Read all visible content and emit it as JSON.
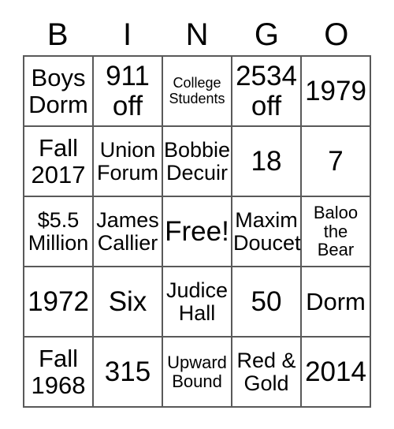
{
  "card": {
    "headers": [
      "B",
      "I",
      "N",
      "G",
      "O"
    ],
    "rows": [
      [
        {
          "text": "Boys\nDorm",
          "size": "fs-lg"
        },
        {
          "text": "911\noff",
          "size": "fs-xl"
        },
        {
          "text": "College\nStudents",
          "size": "fs-xs"
        },
        {
          "text": "2534\noff",
          "size": "fs-xl"
        },
        {
          "text": "1979",
          "size": "fs-xl"
        }
      ],
      [
        {
          "text": "Fall\n2017",
          "size": "fs-lg"
        },
        {
          "text": "Union\nForum",
          "size": "fs-md"
        },
        {
          "text": "Bobbie\nDecuir",
          "size": "fs-md"
        },
        {
          "text": "18",
          "size": "fs-xl"
        },
        {
          "text": "7",
          "size": "fs-xl"
        }
      ],
      [
        {
          "text": "$5.5\nMillion",
          "size": "fs-md"
        },
        {
          "text": "James\nCallier",
          "size": "fs-md"
        },
        {
          "text": "Free!",
          "size": "fs-xl"
        },
        {
          "text": "Maxim\nDoucet",
          "size": "fs-md"
        },
        {
          "text": "Baloo\nthe\nBear",
          "size": "fs-sm"
        }
      ],
      [
        {
          "text": "1972",
          "size": "fs-xl"
        },
        {
          "text": "Six",
          "size": "fs-xl"
        },
        {
          "text": "Judice\nHall",
          "size": "fs-md"
        },
        {
          "text": "50",
          "size": "fs-xl"
        },
        {
          "text": "Dorm",
          "size": "fs-lg"
        }
      ],
      [
        {
          "text": "Fall\n1968",
          "size": "fs-lg"
        },
        {
          "text": "315",
          "size": "fs-xl"
        },
        {
          "text": "Upward\nBound",
          "size": "fs-sm"
        },
        {
          "text": "Red &\nGold",
          "size": "fs-md"
        },
        {
          "text": "2014",
          "size": "fs-xl"
        }
      ]
    ]
  }
}
